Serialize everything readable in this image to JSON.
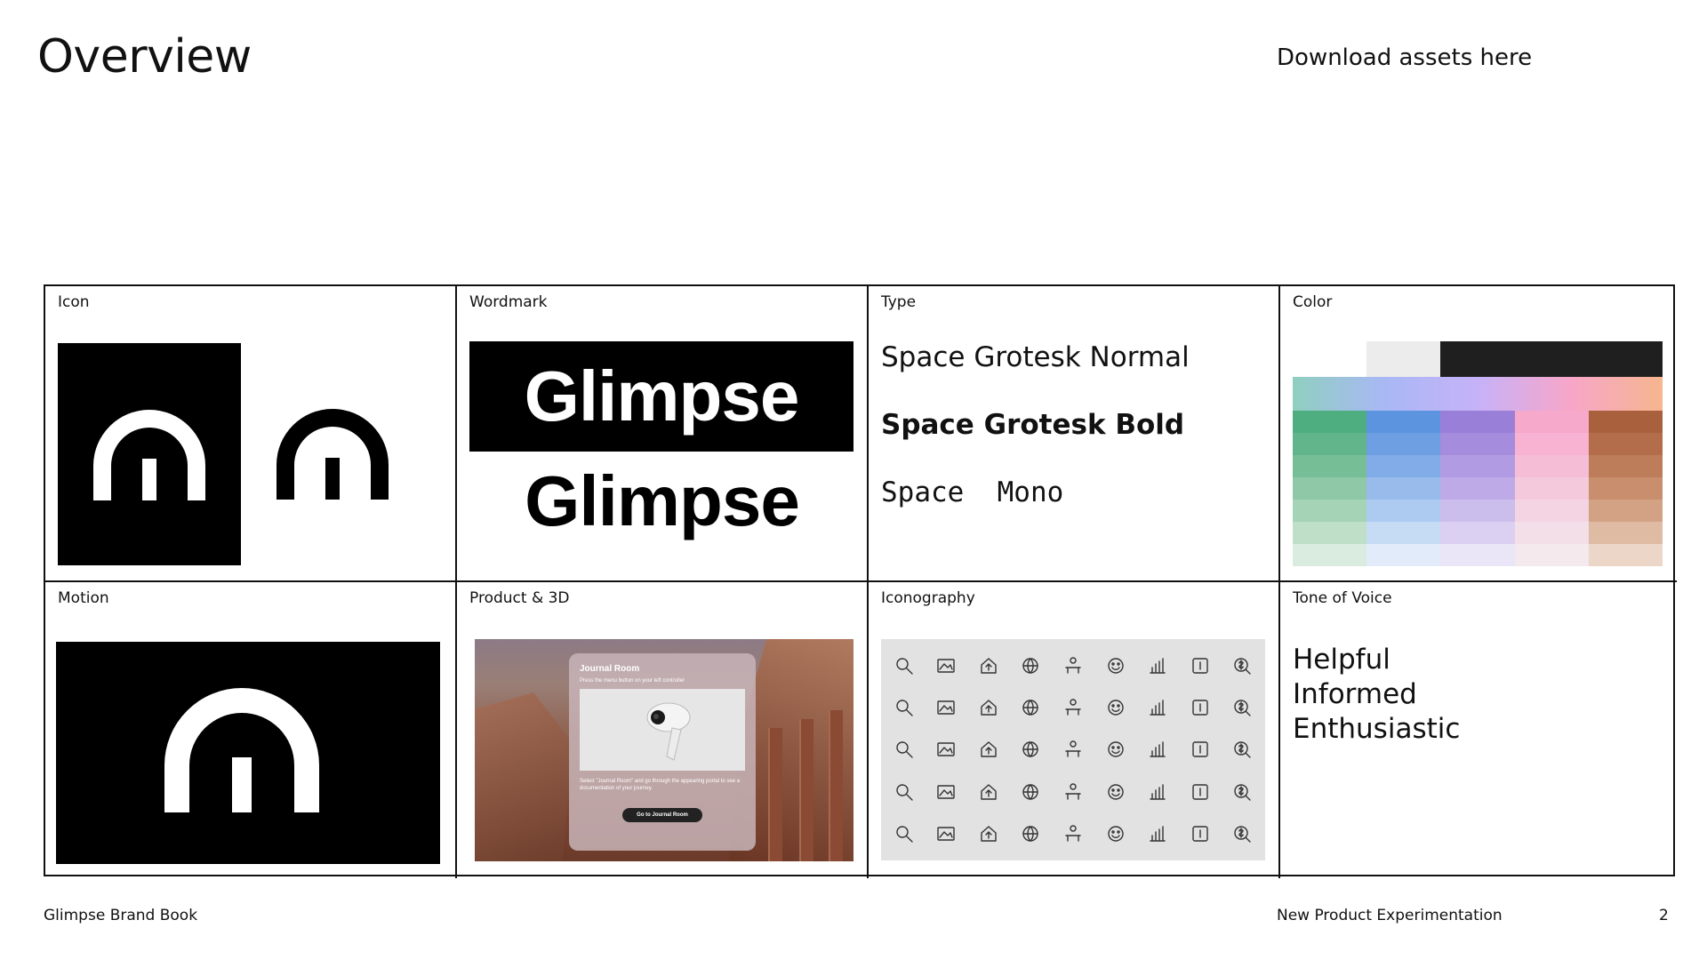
{
  "title": "Overview",
  "download_link": "Download assets here",
  "cells": {
    "icon": {
      "label": "Icon"
    },
    "wordmark": {
      "label": "Wordmark",
      "text": "Glimpse"
    },
    "type": {
      "label": "Type",
      "normal": "Space Grotesk Normal",
      "bold": "Space Grotesk Bold",
      "mono": "Space  Mono"
    },
    "color": {
      "label": "Color",
      "top_colors": {
        "light": "#ececec",
        "dark": "#1f1f1f"
      },
      "gradient": [
        "#8fcfc0",
        "#a9b8f5",
        "#c6b2f8",
        "#f7a6c9",
        "#f6b68e"
      ],
      "columns": [
        [
          "#4fae7f",
          "#62b48a",
          "#76be96",
          "#8ec8a6",
          "#a5d3b6",
          "#bfdfc9",
          "#d9ecdf"
        ],
        [
          "#5d94e0",
          "#6e9fe3",
          "#82ace7",
          "#98bbeb",
          "#adcaf0",
          "#c6dbf4",
          "#e1ebfa"
        ],
        [
          "#9a7fd9",
          "#a58cdd",
          "#b19be2",
          "#bdaae6",
          "#cbbdec",
          "#dbd0f2",
          "#ebe5f8"
        ],
        [
          "#f7a9cc",
          "#f7b3d1",
          "#f6bed6",
          "#f5c9dc",
          "#f4d4e2",
          "#f3dfe7",
          "#f4e9ed"
        ],
        [
          "#a8603d",
          "#b36d4a",
          "#be7d5a",
          "#c88e6d",
          "#d3a285",
          "#dfbba4",
          "#ecd6c8"
        ]
      ]
    },
    "motion": {
      "label": "Motion"
    },
    "product": {
      "label": "Product & 3D",
      "panel_title": "Journal Room",
      "panel_subtitle": "Press the menu button on your left controller",
      "panel_desc": "Select \"Journal Room\" and go through the appearing portal to see a documentation of your journey.",
      "panel_button": "Go to Journal Room"
    },
    "iconography": {
      "label": "Iconography",
      "icons": [
        "search-heart-icon",
        "image-gallery-icon",
        "home-upload-icon",
        "globe-heart-icon",
        "person-desk-icon",
        "smile-badge-icon",
        "bar-chart-icon",
        "info-square-icon",
        "money-search-icon",
        "lightbulb-icon",
        "support-24-7-icon",
        "chat-heart-icon",
        "gift-icon",
        "dumbbell-heart-icon",
        "wifi-home-icon",
        "lotus-icon",
        "airplane-icon",
        "network-icon",
        "gear-cycle-icon",
        "id-badge-icon",
        "molecule-icon",
        "cash-stack-icon",
        "heart-hands-icon",
        "shield-icon",
        "age-18-plus-icon",
        "crowd-icon",
        "document-card-icon",
        "photo-frame-icon",
        "vr-headset-icon",
        "location-pin-icon",
        "music-note-icon",
        "cake-icon",
        "trend-line-icon",
        "food-bowl-icon",
        "radio-tower-icon",
        "clapperboard-icon",
        "robot-chat-icon",
        "robot-icon",
        "file-lock-icon",
        "satellite-dish-icon",
        "tent-icon",
        "shopping-cart-icon",
        "leaf-icon",
        "rainbow-icon",
        "code-window-icon"
      ]
    },
    "tone": {
      "label": "Tone of Voice",
      "lines": [
        "Helpful",
        "Informed",
        "Enthusiastic"
      ]
    }
  },
  "footer": {
    "left": "Glimpse Brand Book",
    "center": "New Product Experimentation",
    "page": "2"
  }
}
